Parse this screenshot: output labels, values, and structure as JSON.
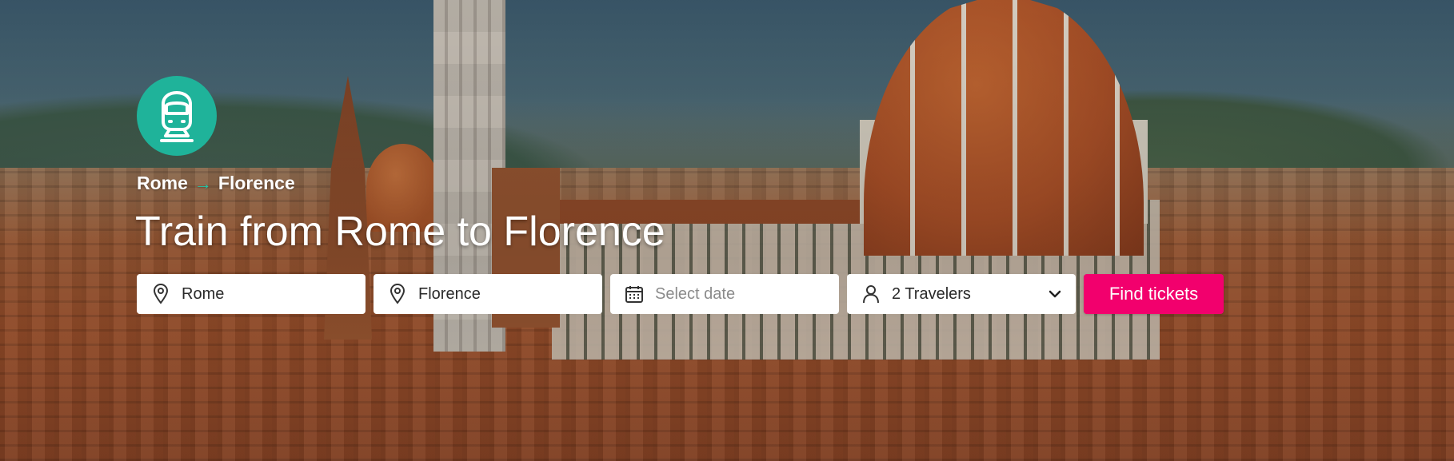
{
  "hero": {
    "breadcrumb": {
      "from": "Rome",
      "arrow": "→",
      "to": "Florence"
    },
    "title": "Train from Rome to Florence",
    "badge_icon": "train-icon",
    "badge_color": "#1fb39a"
  },
  "search": {
    "origin": {
      "value": "Rome",
      "icon": "location-pin-icon"
    },
    "destination": {
      "value": "Florence",
      "icon": "location-pin-icon"
    },
    "date": {
      "placeholder": "Select date",
      "icon": "calendar-icon"
    },
    "travelers": {
      "value": "2 Travelers",
      "icon": "person-icon",
      "dropdown_icon": "chevron-down-icon"
    },
    "submit_label": "Find tickets",
    "submit_color": "#f2006d"
  }
}
